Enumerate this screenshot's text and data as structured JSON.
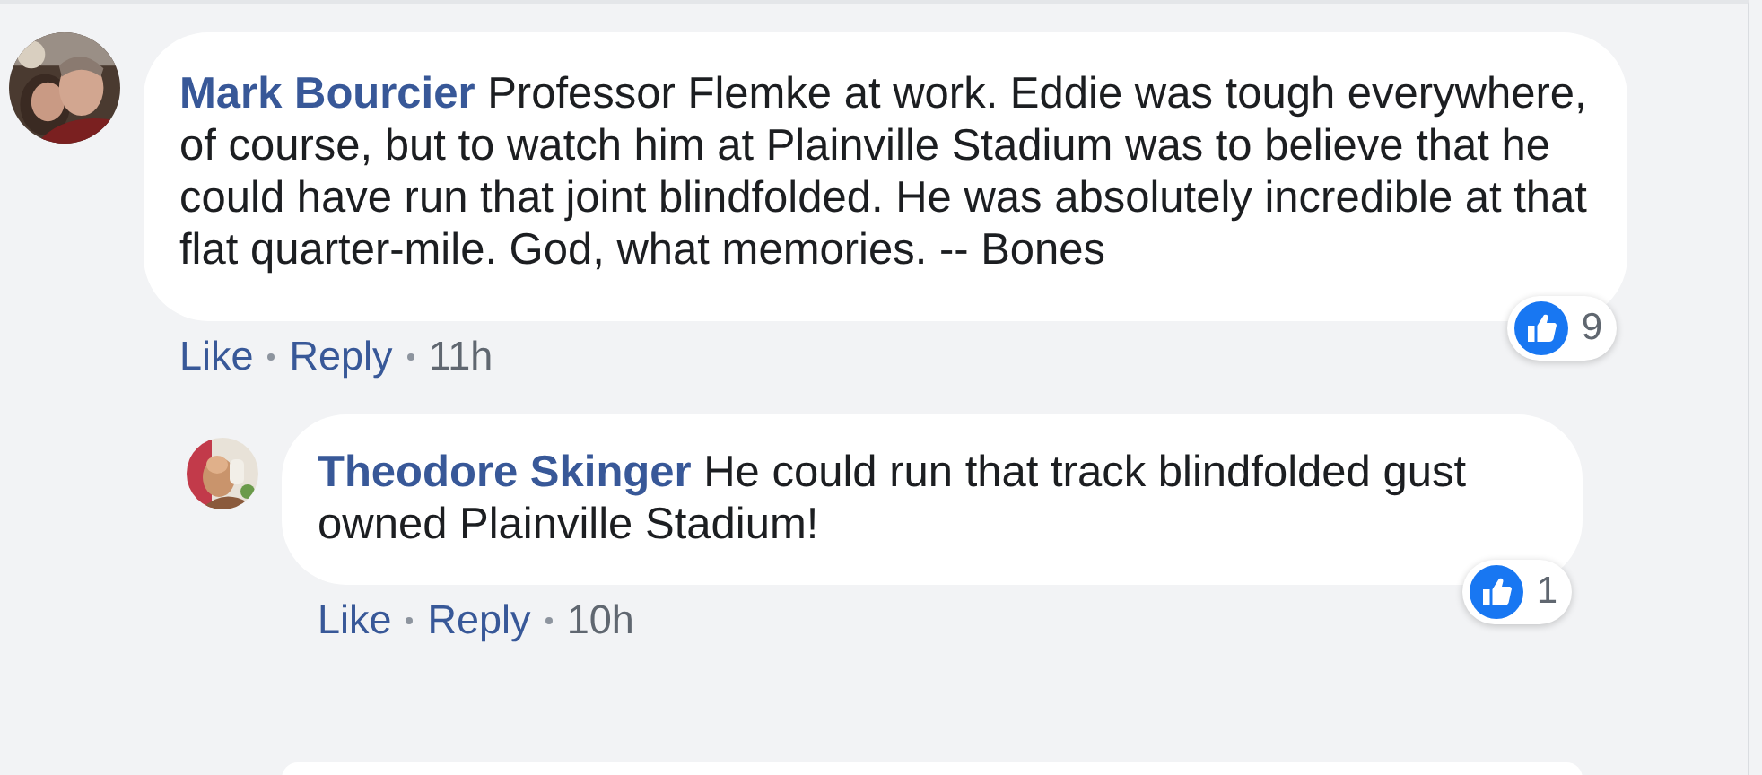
{
  "comments": [
    {
      "author": "Mark Bourcier",
      "text": "Professor Flemke at work. Eddie was tough everywhere, of course, but to watch him at Plainville Stadium was to believe that he could have run that joint blindfolded. He was absolutely incredible at that flat quarter-mile. God, what memories. -- Bones",
      "actions": [
        "Like",
        "Reply"
      ],
      "time": "11h",
      "reaction_count": "9",
      "replies": [
        {
          "author": "Theodore Skinger",
          "text": "He could run that track blindfolded gust owned Plainville Stadium!",
          "actions": [
            "Like",
            "Reply"
          ],
          "time": "10h",
          "reaction_count": "1"
        }
      ]
    }
  ]
}
